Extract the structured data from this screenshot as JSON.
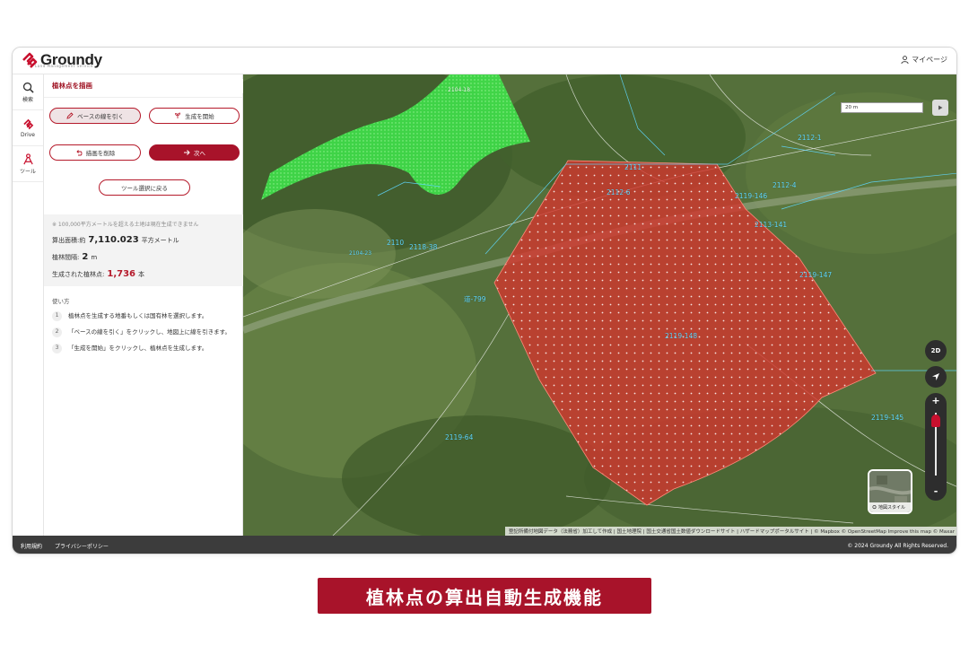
{
  "app": {
    "logo_text": "Groundy",
    "logo_sub": "Land Management Service",
    "mypage": "マイページ"
  },
  "rail": [
    {
      "label": "検索",
      "icon": "search-icon"
    },
    {
      "label": "Drive",
      "icon": "drive-icon"
    },
    {
      "label": "ツール",
      "icon": "tool-icon"
    }
  ],
  "panel": {
    "title": "植林点を描画",
    "buttons": {
      "draw_base": "ベースの線を引く",
      "generate": "生成を開始",
      "delete": "描画を削除",
      "next": "次へ",
      "back_to_tools": "ツール選択に戻る"
    },
    "info": {
      "note": "※ 100,000平方メートルを超える土地は現在生成できません",
      "area_label": "算出面積:約",
      "area_value": "7,110.023",
      "area_unit": "平方メートル",
      "interval_label": "植林間隔:",
      "interval_value": "2",
      "interval_unit": "m",
      "points_label": "生成された植林点:",
      "points_value": "1,736",
      "points_unit": "本"
    },
    "usage": {
      "heading": "使い方",
      "steps": [
        {
          "num": "1",
          "text": "植林点を生成する地番もしくは国有林を選択します。"
        },
        {
          "num": "2",
          "text": "「ベースの線を引く」をクリックし、地図上に線を引きます。"
        },
        {
          "num": "3",
          "text": "「生成を開始」をクリックし、植林点を生成します。"
        }
      ]
    }
  },
  "map": {
    "parcels": [
      {
        "label": "2119-148"
      },
      {
        "label": "2119-147"
      },
      {
        "label": "2119-145"
      },
      {
        "label": "2119-146"
      },
      {
        "label": "2119-64"
      },
      {
        "label": "2118-38"
      },
      {
        "label": "2112-6"
      },
      {
        "label": "2112-1"
      },
      {
        "label": "2111"
      },
      {
        "label": "2110"
      },
      {
        "label": "道-799"
      },
      {
        "label": "2104-18"
      },
      {
        "label": "2104-23"
      },
      {
        "label": "2113-141"
      },
      {
        "label": "2112-4"
      }
    ],
    "scale_label": "20 m",
    "view_mode": "2D",
    "style_label": "地図スタイル",
    "attribution": "登記所備付地図データ（法務省）加工して作成 | 国土地理院 | 国土交通省国土数値ダウンロードサイト | ハザードマップポータルサイト | © Mapbox © OpenStreetMap Improve this map © Maxar",
    "colors": {
      "red_area": "#d0372e",
      "green_area": "#3fe04a",
      "parcel_line": "#5fd8ff"
    }
  },
  "footer": {
    "terms": "利用規約",
    "privacy": "プライバシーポリシー",
    "copyright": "© 2024 Groundy All Rights Reserved."
  },
  "banner": {
    "text": "植林点の算出自動生成機能"
  }
}
